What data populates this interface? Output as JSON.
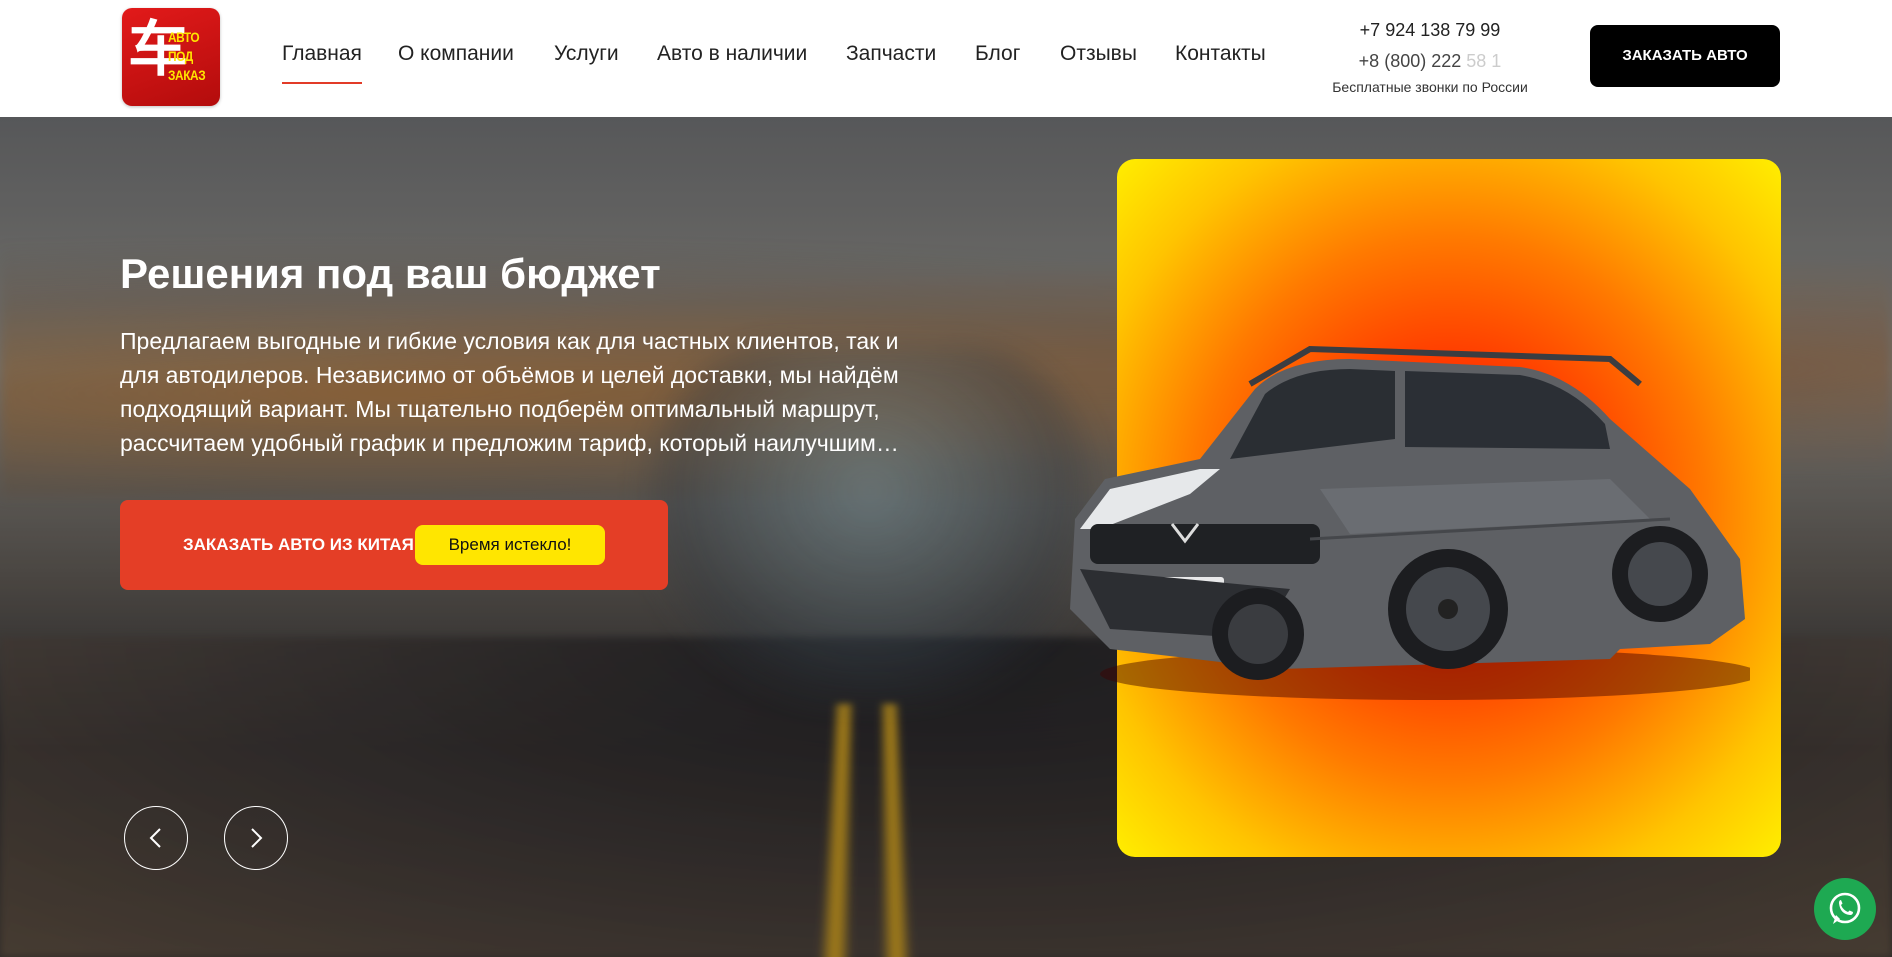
{
  "header": {
    "logo": {
      "char": "车",
      "lines": [
        "АВТО",
        "ПОД",
        "ЗАКАЗ"
      ]
    },
    "nav": [
      {
        "label": "Главная",
        "active": true
      },
      {
        "label": "О компании",
        "active": false
      },
      {
        "label": "Услуги",
        "active": false
      },
      {
        "label": "Авто в наличии",
        "active": false
      },
      {
        "label": "Запчасти",
        "active": false
      },
      {
        "label": "Блог",
        "active": false
      },
      {
        "label": "Отзывы",
        "active": false
      },
      {
        "label": "Контакты",
        "active": false
      }
    ],
    "phone_main": "+7 924 138 79 99",
    "phone_free_visible": "+8 (800) 222",
    "phone_free_faded": "58 1",
    "phone_note": "Бесплатные звонки по России",
    "order_button": "ЗАКАЗАТЬ АВТО"
  },
  "hero": {
    "title": "Решения под ваш бюджет",
    "text": "Предлагаем выгодные и гибкие условия как для частных клиентов, так и для автодилеров. Независимо от объёмов и целей доставки, мы найдём подходящий вариант. Мы тщательно подберём оптимальный маршрут, рассчитаем удобный график и предложим тариф, который наилучшим образом соответствует вашим задачам.",
    "cta_label": "ЗАКАЗАТЬ АВТО ИЗ КИТАЯ",
    "cta_timer": "Время истекло!",
    "prev_icon": "chevron-left-icon",
    "next_icon": "chevron-right-icon"
  },
  "colors": {
    "accent_red": "#e43e26",
    "timer_yellow": "#ffe600",
    "whatsapp_green": "#1ea952"
  }
}
